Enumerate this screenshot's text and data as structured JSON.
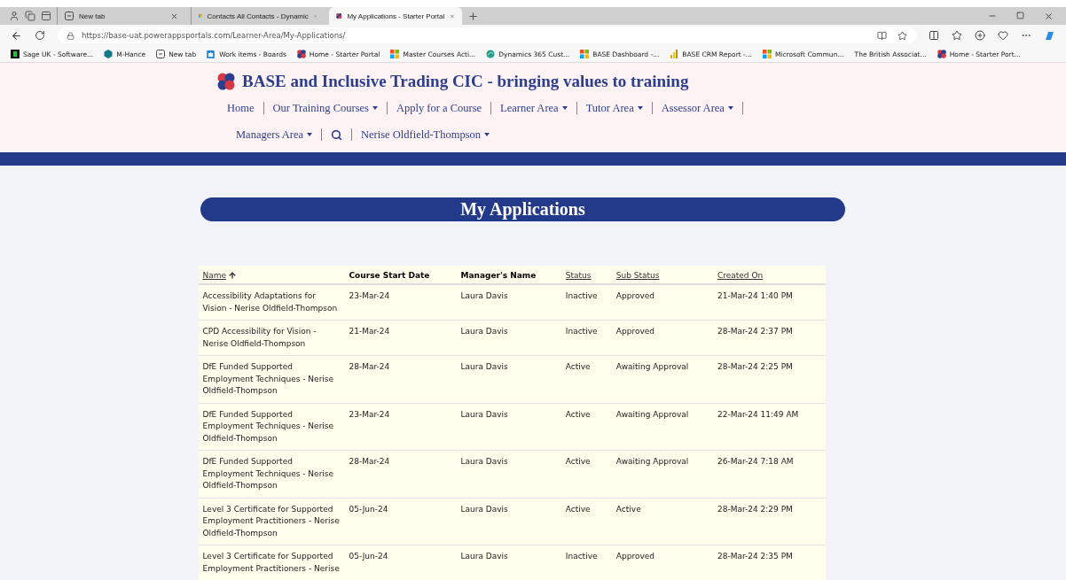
{
  "browser": {
    "tabs": [
      {
        "title": "New tab",
        "selected": false
      },
      {
        "title": "Contacts All Contacts - Dynamic",
        "selected": false
      },
      {
        "title": "My Applications  - Starter Portal",
        "selected": true
      }
    ],
    "address": "https://base-uat.powerappsportals.com/Learner-Area/My-Applications/",
    "bookmarks": [
      {
        "title": "Sage UK - Software..."
      },
      {
        "title": "M-Hance"
      },
      {
        "title": "New tab"
      },
      {
        "title": "Work items - Boards"
      },
      {
        "title": "Home  - Starter Portal"
      },
      {
        "title": "Master Courses Acti..."
      },
      {
        "title": "Dynamics 365 Cust..."
      },
      {
        "title": "BASE Dashboard -..."
      },
      {
        "title": "BASE CRM Report -..."
      },
      {
        "title": "Microsoft Commun..."
      },
      {
        "title": "The British Associat..."
      },
      {
        "title": "Home  - Starter Port..."
      }
    ]
  },
  "site": {
    "title": "BASE and Inclusive Trading CIC - bringing values to training",
    "nav": [
      {
        "label": "Home",
        "kind": "link"
      },
      {
        "label": "Our Training Courses",
        "kind": "dropdown"
      },
      {
        "label": "Apply for a Course",
        "kind": "link"
      },
      {
        "label": "Learner Area",
        "kind": "dropdown"
      },
      {
        "label": "Tutor Area",
        "kind": "dropdown"
      },
      {
        "label": "Assessor Area",
        "kind": "dropdown"
      },
      {
        "label": "Managers Area",
        "kind": "dropdown"
      },
      {
        "kind": "search"
      },
      {
        "label": "Nerise Oldfield-Thompson",
        "kind": "dropdown"
      }
    ]
  },
  "page_title": "My Applications",
  "table": {
    "columns": [
      {
        "label": "Name",
        "kind": "sortable",
        "sorted": true
      },
      {
        "label": "Course Start Date",
        "kind": "plain"
      },
      {
        "label": "Manager's Name",
        "kind": "plain"
      },
      {
        "label": "Status",
        "kind": "sortable",
        "sorted": false
      },
      {
        "label": "Sub Status",
        "kind": "sortable",
        "sorted": false
      },
      {
        "label": "Created On",
        "kind": "sortable",
        "sorted": false
      }
    ],
    "rows": [
      [
        "Accessibility Adaptations for Vision - Nerise Oldfield-Thompson",
        "23-Mar-24",
        "Laura Davis",
        "Inactive",
        "Approved",
        "21-Mar-24 1:40 PM"
      ],
      [
        "CPD Accessibility for Vision - Nerise Oldfield-Thompson",
        "21-Mar-24",
        "Laura Davis",
        "Inactive",
        "Approved",
        "28-Mar-24 2:37 PM"
      ],
      [
        "DfE Funded Supported Employment Techniques - Nerise Oldfield-Thompson",
        "28-Mar-24",
        "Laura Davis",
        "Active",
        "Awaiting Approval",
        "28-Mar-24 2:25 PM"
      ],
      [
        "DfE Funded Supported Employment Techniques - Nerise Oldfield-Thompson",
        "23-Mar-24",
        "Laura Davis",
        "Active",
        "Awaiting Approval",
        "22-Mar-24 11:49 AM"
      ],
      [
        "DfE Funded Supported Employment Techniques - Nerise Oldfield-Thompson",
        "28-Mar-24",
        "Laura Davis",
        "Active",
        "Awaiting Approval",
        "26-Mar-24 7:18 AM"
      ],
      [
        "Level 3 Certificate for Supported Employment Practitioners - Nerise Oldfield-Thompson",
        "05-Jun-24",
        "Laura Davis",
        "Active",
        "Active",
        "28-Mar-24 2:29 PM"
      ],
      [
        "Level 3 Certificate for Supported Employment Practitioners - Nerise",
        "05-Jun-24",
        "Laura Davis",
        "Inactive",
        "Approved",
        "28-Mar-24 2:35 PM"
      ]
    ]
  }
}
